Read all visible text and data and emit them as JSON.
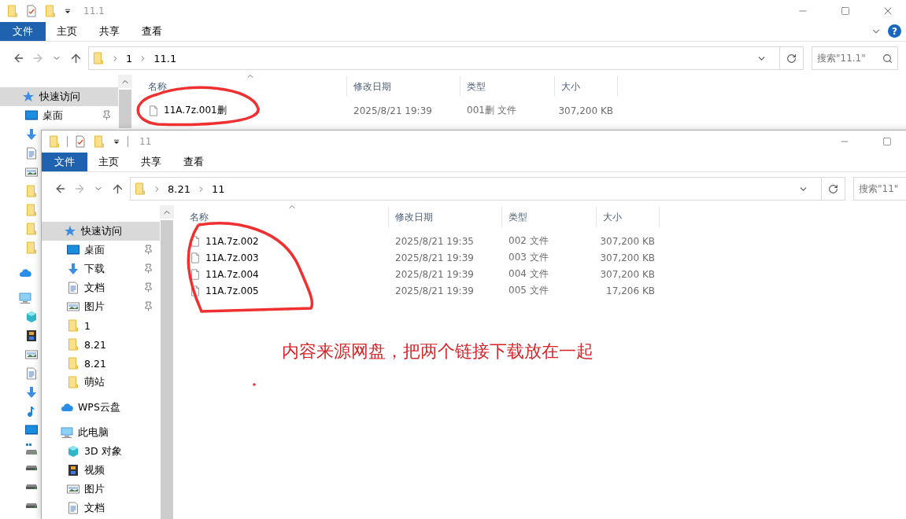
{
  "back_window": {
    "title": "11.1",
    "ribbon_tabs": [
      {
        "label": "文件",
        "selected": true
      },
      {
        "label": "主页",
        "selected": false
      },
      {
        "label": "共享",
        "selected": false
      },
      {
        "label": "查看",
        "selected": false
      }
    ],
    "path": [
      "1",
      "11.1"
    ],
    "search": {
      "placeholder": "搜索\"11.1\""
    },
    "help_label": "?",
    "sidebar": [
      {
        "kind": "star",
        "label": "快速访问",
        "selected": true,
        "children": [
          {
            "kind": "desktop",
            "label": "桌面",
            "pinned": true,
            "selected": false
          },
          {
            "kind": "download",
            "selected": false
          },
          {
            "kind": "document",
            "selected": false
          },
          {
            "kind": "picture",
            "selected": false
          },
          {
            "kind": "folder",
            "selected": false
          },
          {
            "kind": "folder",
            "selected": false
          },
          {
            "kind": "folder",
            "selected": false
          },
          {
            "kind": "folder",
            "selected": false
          }
        ]
      },
      {
        "kind": "cloud",
        "selected": false
      },
      {
        "kind": "computer",
        "selected": false,
        "children": [
          {
            "kind": "cube",
            "selected": false
          },
          {
            "kind": "film",
            "selected": false
          },
          {
            "kind": "picture",
            "selected": false
          },
          {
            "kind": "document",
            "selected": false
          },
          {
            "kind": "download",
            "selected": false
          },
          {
            "kind": "music",
            "selected": false
          },
          {
            "kind": "desktop",
            "selected": false
          },
          {
            "kind": "system_drive",
            "selected": false
          },
          {
            "kind": "drive",
            "selected": false
          },
          {
            "kind": "drive",
            "selected": false
          },
          {
            "kind": "drive",
            "selected": false
          }
        ]
      }
    ],
    "columns": [
      "名称",
      "修改日期",
      "类型",
      "大小"
    ],
    "files": [
      {
        "name": "11A.7z.001删",
        "modified": "2025/8/21 19:39",
        "type": "001删 文件",
        "size": "307,200 KB"
      }
    ]
  },
  "front_window": {
    "title": "11",
    "ribbon_tabs": [
      {
        "label": "文件",
        "selected": true
      },
      {
        "label": "主页",
        "selected": false
      },
      {
        "label": "共享",
        "selected": false
      },
      {
        "label": "查看",
        "selected": false
      }
    ],
    "path": [
      "8.21",
      "11"
    ],
    "search": {
      "placeholder": "搜索\"11\""
    },
    "sidebar": [
      {
        "kind": "star",
        "label": "快速访问",
        "selected": true,
        "children": [
          {
            "kind": "desktop",
            "label": "桌面",
            "pinned": true,
            "selected": false
          },
          {
            "kind": "download",
            "label": "下载",
            "pinned": true,
            "selected": false
          },
          {
            "kind": "document",
            "label": "文档",
            "pinned": true,
            "selected": false
          },
          {
            "kind": "picture",
            "label": "图片",
            "pinned": true,
            "selected": false
          },
          {
            "kind": "folder",
            "label": "1",
            "pinned": false,
            "selected": false
          },
          {
            "kind": "folder",
            "label": "8.21",
            "pinned": false,
            "selected": false
          },
          {
            "kind": "folder",
            "label": "8.21",
            "pinned": false,
            "selected": false
          },
          {
            "kind": "folder",
            "label": "萌站",
            "pinned": false,
            "selected": false
          }
        ]
      },
      {
        "kind": "cloud",
        "label": "WPS云盘",
        "selected": false
      },
      {
        "kind": "computer",
        "label": "此电脑",
        "selected": false,
        "children": [
          {
            "kind": "cube",
            "label": "3D 对象",
            "selected": false
          },
          {
            "kind": "film",
            "label": "视频",
            "selected": false
          },
          {
            "kind": "picture",
            "label": "图片",
            "selected": false
          },
          {
            "kind": "document",
            "label": "文档",
            "selected": false
          }
        ]
      }
    ],
    "columns": [
      "名称",
      "修改日期",
      "类型",
      "大小"
    ],
    "files": [
      {
        "name": "11A.7z.002",
        "modified": "2025/8/21 19:35",
        "type": "002 文件",
        "size": "307,200 KB"
      },
      {
        "name": "11A.7z.003",
        "modified": "2025/8/21 19:39",
        "type": "003 文件",
        "size": "307,200 KB"
      },
      {
        "name": "11A.7z.004",
        "modified": "2025/8/21 19:39",
        "type": "004 文件",
        "size": "307,200 KB"
      },
      {
        "name": "11A.7z.005",
        "modified": "2025/8/21 19:39",
        "type": "005 文件",
        "size": "17,206 KB"
      }
    ]
  },
  "annotation": {
    "text": "内容来源网盘，把两个链接下载放在一起"
  }
}
